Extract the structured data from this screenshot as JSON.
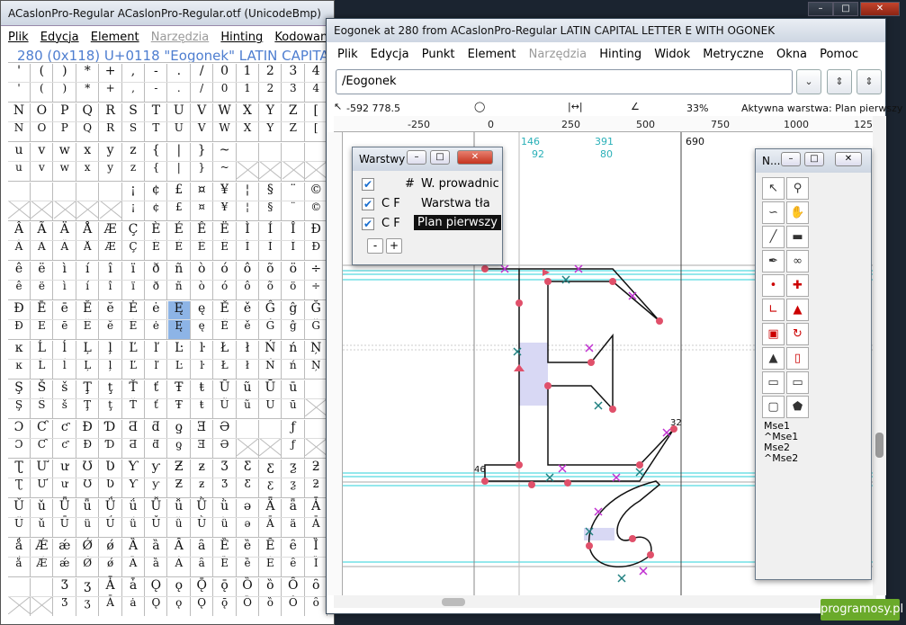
{
  "font_window": {
    "title": "ACaslonPro-Regular  ACaslonPro-Regular.otf (UnicodeBmp)",
    "menu": [
      "Plik",
      "Edycja",
      "Element",
      "Narzędzia",
      "Hinting",
      "Kodowanie"
    ],
    "glyph_info": "280 (0x118) U+0118 \"Eogonek\" LATIN CAPITAL LETTER E WITH OGONEK",
    "rows": [
      [
        "'",
        "(",
        ")",
        "*",
        "+",
        ",",
        "-",
        ".",
        "/",
        "0",
        "1",
        "2",
        "3",
        "4"
      ],
      [
        "N",
        "O",
        "P",
        "Q",
        "R",
        "S",
        "T",
        "U",
        "V",
        "W",
        "X",
        "Y",
        "Z",
        "["
      ],
      [
        "u",
        "v",
        "w",
        "x",
        "y",
        "z",
        "{",
        "|",
        "}",
        "~",
        "",
        "",
        "",
        ""
      ],
      [
        "",
        "",
        "",
        "",
        "",
        "¡",
        "¢",
        "£",
        "¤",
        "¥",
        "¦",
        "§",
        "¨",
        "©"
      ],
      [
        "Â",
        "Ã",
        "Ä",
        "Å",
        "Æ",
        "Ç",
        "È",
        "É",
        "Ê",
        "Ë",
        "Ì",
        "Í",
        "Î",
        "Ð"
      ],
      [
        "ê",
        "ë",
        "ì",
        "í",
        "î",
        "ï",
        "ð",
        "ñ",
        "ò",
        "ó",
        "ô",
        "õ",
        "ö",
        "÷"
      ],
      [
        "Đ",
        "Ē",
        "ē",
        "Ĕ",
        "ĕ",
        "Ė",
        "ė",
        "Ę",
        "ę",
        "Ě",
        "ě",
        "Ĝ",
        "ĝ",
        "Ğ"
      ],
      [
        "ĸ",
        "Ĺ",
        "ĺ",
        "Ļ",
        "ļ",
        "Ľ",
        "ľ",
        "Ŀ",
        "ŀ",
        "Ł",
        "ł",
        "Ń",
        "ń",
        "Ņ"
      ],
      [
        "Ş",
        "Š",
        "š",
        "Ţ",
        "ţ",
        "Ť",
        "ť",
        "Ŧ",
        "ŧ",
        "Ũ",
        "ũ",
        "Ū",
        "ū",
        ""
      ],
      [
        "Ɔ",
        "Ƈ",
        "ƈ",
        "Ɖ",
        "Ɗ",
        "Ƌ",
        "ƌ",
        "ƍ",
        "Ǝ",
        "Ə",
        "",
        "",
        "ƒ",
        ""
      ],
      [
        "Ʈ",
        "Ư",
        "ư",
        "Ʊ",
        "Ʋ",
        "Ƴ",
        "ƴ",
        "Ƶ",
        "ƶ",
        "Ʒ",
        "Ƹ",
        "ƹ",
        "ƺ",
        "ƻ"
      ],
      [
        "Ǔ",
        "ǔ",
        "Ǖ",
        "ǖ",
        "Ǘ",
        "ǘ",
        "Ǚ",
        "ǚ",
        "Ǜ",
        "ǜ",
        "ǝ",
        "Ǟ",
        "ǟ",
        "Ǡ"
      ],
      [
        "ǻ",
        "Ǽ",
        "ǽ",
        "Ǿ",
        "ǿ",
        "Ȁ",
        "ȁ",
        "Ȃ",
        "ȃ",
        "Ȅ",
        "ȅ",
        "Ȇ",
        "ȇ",
        "Ȉ"
      ],
      [
        "",
        "",
        "Ʒ",
        "ʒ",
        "Ǡ",
        "ǡ",
        "Ǫ",
        "ǫ",
        "Ǭ",
        "ǭ",
        "Ȍ",
        "ȍ",
        "Ȏ",
        "ȏ"
      ]
    ],
    "selected_glyph": "Ę"
  },
  "glyph_window": {
    "title": "Eogonek at 280 from ACaslonPro-Regular LATIN CAPITAL LETTER E WITH OGONEK",
    "menu": [
      "Plik",
      "Edycja",
      "Punkt",
      "Element",
      "Narzędzia",
      "Hinting",
      "Widok",
      "Metryczne",
      "Okna",
      "Pomoc"
    ],
    "glyph_name": "/Eogonek",
    "coords": "-592 778.5",
    "zoom": "33%",
    "active_layer": "Aktywna warstwa: Plan pierwszy",
    "ruler_ticks": [
      "-250",
      "0",
      "250",
      "500",
      "750",
      "1000",
      "125"
    ],
    "metric_labels": [
      "146",
      "92",
      "391",
      "80",
      "690"
    ],
    "point_labels": [
      "32",
      "46"
    ]
  },
  "layers_palette": {
    "title": "Warstwy",
    "rows": [
      {
        "flags": "#",
        "name": "W. prowadnic",
        "selected": false
      },
      {
        "flags": "C  F",
        "name": "Warstwa tła",
        "selected": false
      },
      {
        "flags": "C  F",
        "name": "Plan pierwszy",
        "selected": true
      }
    ],
    "minus": "-",
    "plus": "+"
  },
  "tools_palette": {
    "title": "N...",
    "mouse_labels": [
      "Mse1",
      "^Mse1",
      "Mse2",
      "^Mse2"
    ]
  },
  "watermark": "programosy.pl",
  "colors": {
    "accent_blue": "#4e7ed0",
    "guide_cyan": "#2ad0d8",
    "point_red": "#e0506a",
    "point_magenta": "#c030d0",
    "point_teal": "#208080"
  }
}
